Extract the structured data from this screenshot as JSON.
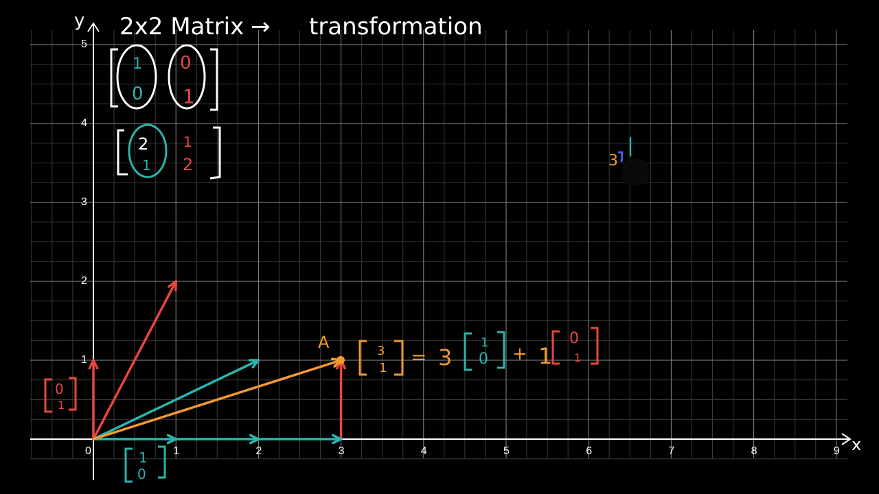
{
  "title": {
    "left": "2x2 Matrix",
    "arrow": "→",
    "right": "transformation"
  },
  "axes": {
    "x_label": "x",
    "y_label": "y",
    "x_ticks": [
      "0",
      "1",
      "2",
      "3",
      "4",
      "5",
      "6",
      "7",
      "8",
      "9"
    ],
    "y_ticks": [
      "1",
      "2",
      "3",
      "4",
      "5"
    ],
    "x_range": [
      -0.75,
      9.1
    ],
    "y_range": [
      -0.25,
      5.1
    ]
  },
  "matrices": {
    "standard": {
      "col1": [
        "1",
        "0"
      ],
      "col2": [
        "0",
        "1"
      ]
    },
    "transform": {
      "col1": [
        "2",
        "1"
      ],
      "col2": [
        "1",
        "2"
      ]
    }
  },
  "point_a": {
    "label": "A",
    "vector": [
      "3",
      "1"
    ],
    "equals": "=",
    "coef1": "3",
    "basis1": [
      "1",
      "0"
    ],
    "plus": "+",
    "coef2": "1",
    "basis2": [
      "0",
      "1"
    ]
  },
  "labels": {
    "e2": [
      "0",
      "1"
    ],
    "e1": [
      "1",
      "0"
    ],
    "corner_mark": "3"
  },
  "vectors": [
    {
      "name": "e1",
      "from": [
        0,
        0
      ],
      "to": [
        1,
        0
      ],
      "color": "#2bb5ad"
    },
    {
      "name": "e2",
      "from": [
        0,
        0
      ],
      "to": [
        0,
        1
      ],
      "color": "#e8473f"
    },
    {
      "name": "t-e1",
      "from": [
        0,
        0
      ],
      "to": [
        2,
        1
      ],
      "color": "#2bb5ad"
    },
    {
      "name": "t-e2",
      "from": [
        0,
        0
      ],
      "to": [
        1,
        2
      ],
      "color": "#e8473f"
    },
    {
      "name": "a-vector",
      "from": [
        0,
        0
      ],
      "to": [
        3,
        1
      ],
      "color": "#f39a2f"
    },
    {
      "name": "a-up",
      "from": [
        3,
        0
      ],
      "to": [
        3,
        1
      ],
      "color": "#e8473f"
    },
    {
      "name": "along-x-1",
      "from": [
        1,
        0
      ],
      "to": [
        2,
        0
      ],
      "color": "#2bb5ad"
    },
    {
      "name": "along-x-2",
      "from": [
        2,
        0
      ],
      "to": [
        3,
        0
      ],
      "color": "#2bb5ad"
    }
  ],
  "colors": {
    "teal": "#2bb5ad",
    "red": "#e8473f",
    "orange": "#f39a2f",
    "white": "#ffffff",
    "grid_major": "#8a8a8a",
    "grid_minor": "#3a3a3a"
  }
}
